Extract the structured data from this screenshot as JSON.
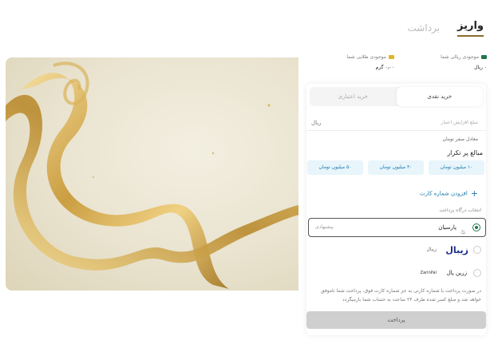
{
  "header": {
    "back_icon": "arrow-right-icon"
  },
  "tabs": [
    {
      "label": "واریز",
      "active": true
    },
    {
      "label": "برداشت",
      "active": false
    }
  ],
  "balances": {
    "rial": {
      "label": "موجودی ریالی شما",
      "value": "۰ ریال",
      "icon": "wallet-icon",
      "color": "#1f7a4a"
    },
    "gold": {
      "label": "موجودی طلایی شما",
      "value": "۰٫۰۰ گرم",
      "icon": "gold-bar-icon",
      "color": "#e0b52a"
    }
  },
  "subtabs": [
    {
      "label": "خرید نقدی",
      "active": true
    },
    {
      "label": "خرید اعتباری",
      "active": false
    }
  ],
  "amount": {
    "placeholder": "مبلغ افزایش اعتبار",
    "unit": "ریال",
    "equivalent": "معادل صفر تومان"
  },
  "frequent": {
    "title": "مبالغ پر تکرار",
    "chips": [
      "۱۰ میلیون تومان",
      "۳۰ میلیون تومان",
      "۵۰ میلیون تومان"
    ]
  },
  "add_card": "افزودن شماره کارت",
  "gateway": {
    "label": "انتخاب درگاه پرداخت",
    "options": [
      {
        "name": "پارسیان",
        "note": "پیشنهادی",
        "selected": true,
        "icon": "parsian-logo-icon"
      },
      {
        "name": "زیبال",
        "brand": "زیبال",
        "selected": false,
        "icon": "zibal-logo-icon"
      },
      {
        "name": "زرین پال",
        "tiny": "ZarinPal",
        "selected": false,
        "icon": "zarinpal-logo-icon"
      }
    ]
  },
  "disclaimer": "در صورت پرداخت با شماره کارتی به جز شماره کارت فوق، پرداخت شما ناموفق خواهد شد و مبلغ کسر شده طرف ۲۴ ساعت به حساب شما بازمیگردد",
  "pay_button": "پرداخت",
  "colors": {
    "accent": "#1a7aa8",
    "chip_bg": "#e8f5fb",
    "brand_green": "#1f7a4a",
    "gold": "#c9a23d"
  }
}
